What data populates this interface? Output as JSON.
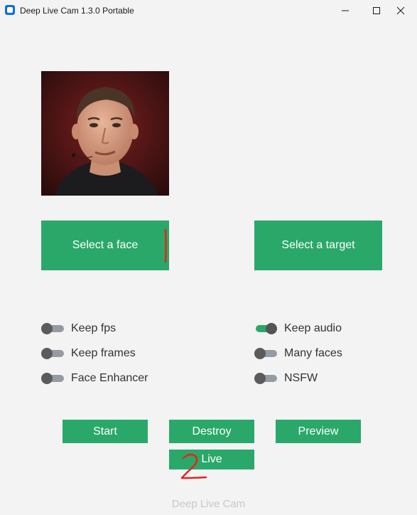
{
  "window": {
    "title": "Deep Live Cam 1.3.0 Portable",
    "minimize_icon": "minimize-icon",
    "maximize_icon": "maximize-icon",
    "close_icon": "close-icon"
  },
  "source_preview": {
    "image": "source-face-photo"
  },
  "buttons": {
    "select_face": "Select a face",
    "select_target": "Select a target",
    "start": "Start",
    "destroy": "Destroy",
    "preview": "Preview",
    "live": "Live"
  },
  "switches": {
    "left": [
      {
        "label": "Keep fps",
        "checked": false
      },
      {
        "label": "Keep frames",
        "checked": false
      },
      {
        "label": "Face Enhancer",
        "checked": false
      }
    ],
    "right": [
      {
        "label": "Keep audio",
        "checked": true
      },
      {
        "label": "Many faces",
        "checked": false
      },
      {
        "label": "NSFW",
        "checked": false
      }
    ]
  },
  "footer": {
    "text": "Deep Live Cam"
  },
  "annotations": {
    "marks": [
      "1",
      "2"
    ]
  },
  "colors": {
    "accent": "#2aa86a",
    "background": "#f3f3f3",
    "switch_off_track": "#949ba3",
    "switch_knob": "#5b5b5b",
    "annotation": "#e8231a",
    "footer_text": "#c8c8c8"
  }
}
